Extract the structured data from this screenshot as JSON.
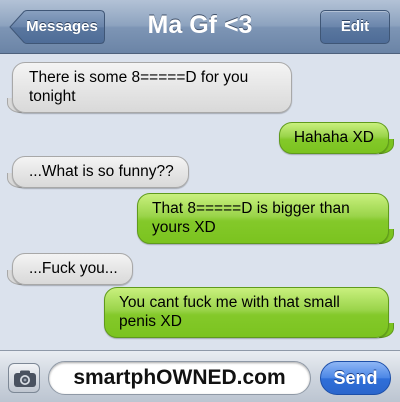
{
  "header": {
    "back_label": "Messages",
    "title": "Ma Gf <3",
    "edit_label": "Edit"
  },
  "messages": [
    {
      "side": "received",
      "text": "There is some 8=====D for you tonight"
    },
    {
      "side": "sent",
      "text": "Hahaha XD"
    },
    {
      "side": "received",
      "text": "...What is so funny??"
    },
    {
      "side": "sent",
      "text": "That 8=====D is bigger than yours XD"
    },
    {
      "side": "received",
      "text": "...Fuck you..."
    },
    {
      "side": "sent",
      "text": "You cant fuck me with that small penis XD"
    }
  ],
  "input": {
    "camera_icon": "camera-icon",
    "value": "smartphOWNED.com",
    "send_label": "Send"
  },
  "colors": {
    "received_bubble": "#e6e6e6",
    "sent_bubble": "#8ccf32",
    "send_button": "#2f6fd9",
    "background": "#dbe2ed"
  }
}
